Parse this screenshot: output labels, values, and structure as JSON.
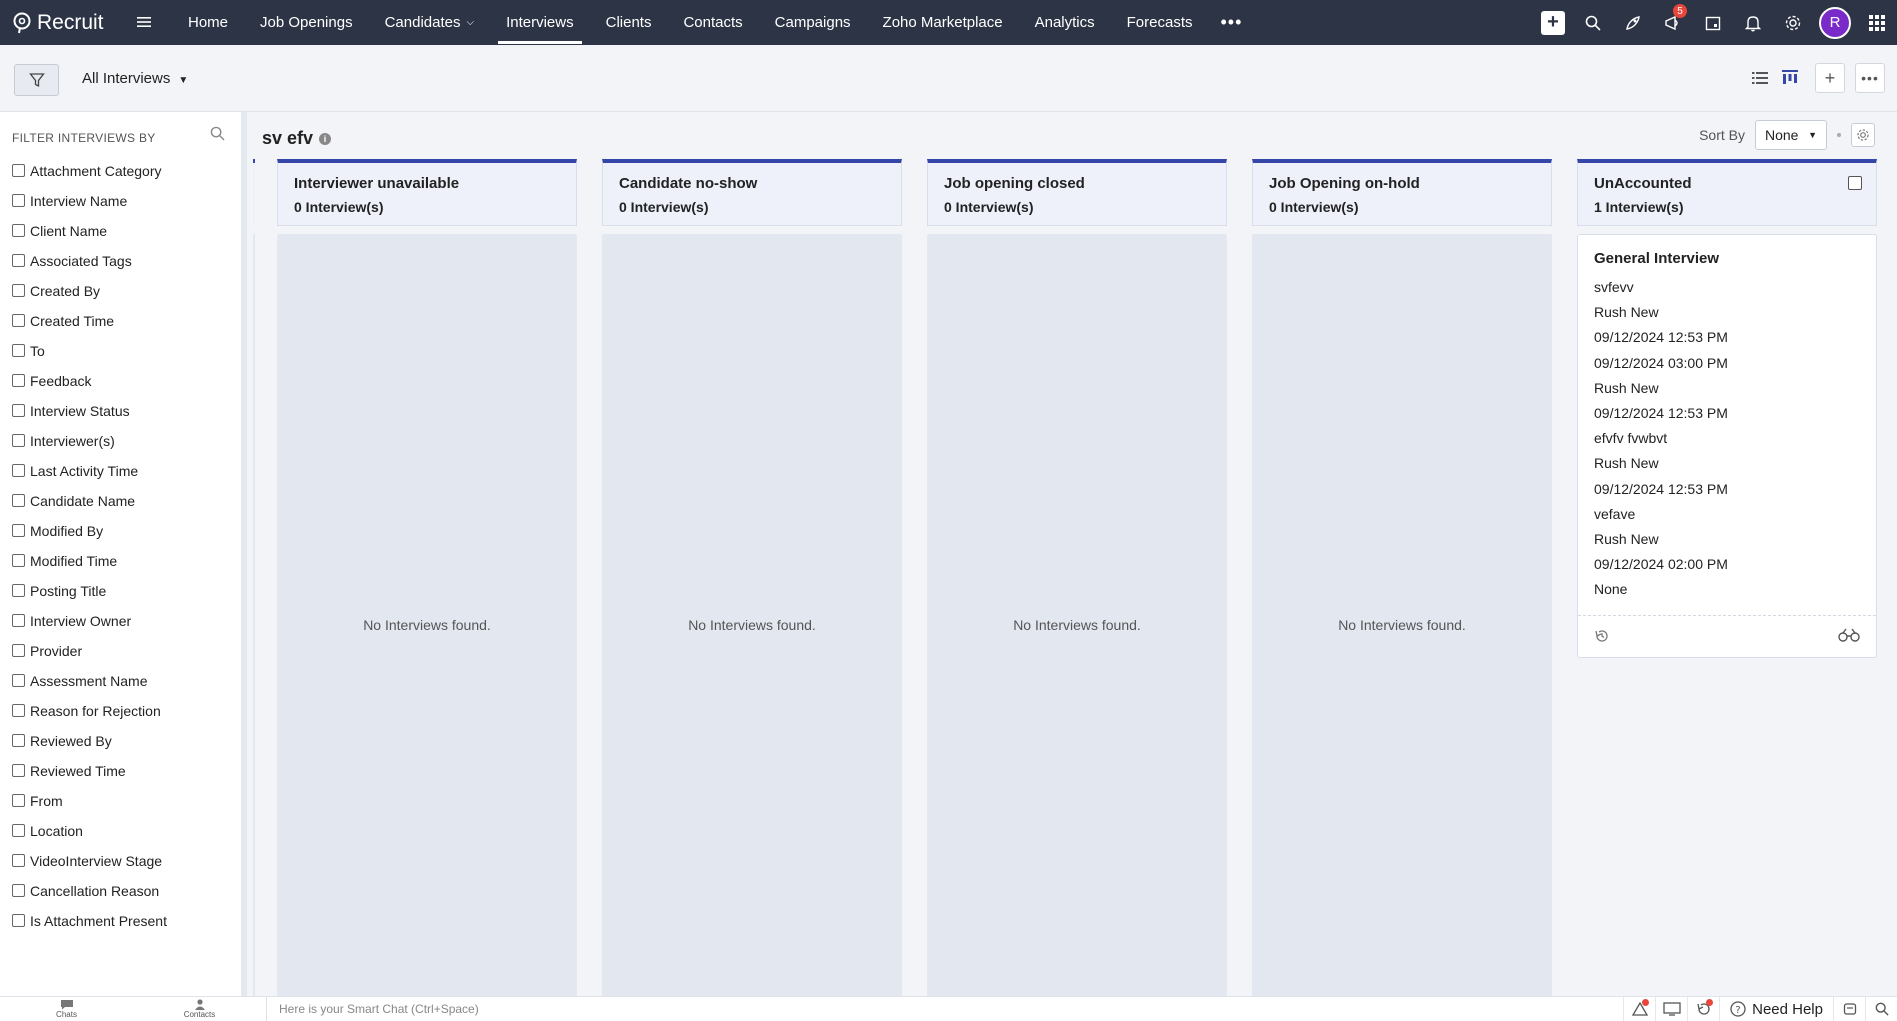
{
  "app": {
    "name": "Recruit"
  },
  "nav": {
    "items": [
      {
        "label": "Home",
        "active": false,
        "dropdown": false
      },
      {
        "label": "Job Openings",
        "active": false,
        "dropdown": false
      },
      {
        "label": "Candidates",
        "active": false,
        "dropdown": true
      },
      {
        "label": "Interviews",
        "active": true,
        "dropdown": false
      },
      {
        "label": "Clients",
        "active": false,
        "dropdown": false
      },
      {
        "label": "Contacts",
        "active": false,
        "dropdown": false
      },
      {
        "label": "Campaigns",
        "active": false,
        "dropdown": false
      },
      {
        "label": "Zoho Marketplace",
        "active": false,
        "dropdown": false
      },
      {
        "label": "Analytics",
        "active": false,
        "dropdown": false
      },
      {
        "label": "Forecasts",
        "active": false,
        "dropdown": false
      }
    ],
    "notification_count": "5",
    "avatar_initial": "R"
  },
  "toolbar": {
    "view_name": "All Interviews"
  },
  "sidebar": {
    "heading": "FILTER INTERVIEWS BY",
    "filters": [
      "Attachment Category",
      "Interview Name",
      "Client Name",
      "Associated Tags",
      "Created By",
      "Created Time",
      "To",
      "Feedback",
      "Interview Status",
      "Interviewer(s)",
      "Last Activity Time",
      "Candidate Name",
      "Modified By",
      "Modified Time",
      "Posting Title",
      "Interview Owner",
      "Provider",
      "Assessment Name",
      "Reason for Rejection",
      "Reviewed By",
      "Reviewed Time",
      "From",
      "Location",
      "VideoInterview Stage",
      "Cancellation Reason",
      "Is Attachment Present"
    ]
  },
  "main": {
    "title": "sv efv",
    "sort_label": "Sort By",
    "sort_value": "None",
    "empty_text": "No Interviews found.",
    "columns": [
      {
        "title": "Interviewer unavailable",
        "count": "0 Interview(s)"
      },
      {
        "title": "Candidate no-show",
        "count": "0 Interview(s)"
      },
      {
        "title": "Job opening closed",
        "count": "0 Interview(s)"
      },
      {
        "title": "Job Opening on-hold",
        "count": "0 Interview(s)"
      },
      {
        "title": "UnAccounted",
        "count": "1 Interview(s)"
      }
    ],
    "card": {
      "title": "General Interview",
      "lines": [
        "svfevv",
        "Rush New",
        "09/12/2024 12:53 PM",
        "09/12/2024 03:00 PM",
        "Rush New",
        "09/12/2024 12:53 PM",
        "efvfv fvwbvt",
        "Rush New",
        "09/12/2024 12:53 PM",
        "vefave",
        "Rush New",
        "09/12/2024 02:00 PM",
        "None"
      ]
    }
  },
  "bottom": {
    "chats_label": "Chats",
    "contacts_label": "Contacts",
    "chat_placeholder": "Here is your Smart Chat (Ctrl+Space)",
    "help_label": "Need Help"
  },
  "colors": {
    "topbar": "#2c3445",
    "column_accent": "#3546a8",
    "avatar": "#7a2ac9",
    "badge": "#e8453c"
  }
}
